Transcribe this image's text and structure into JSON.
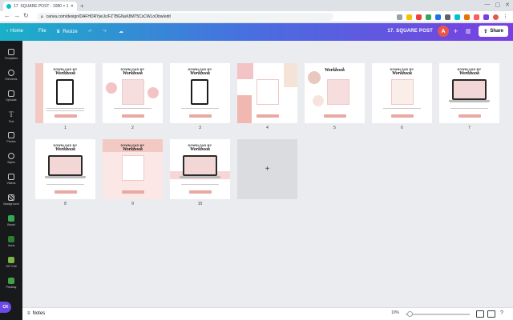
{
  "browser": {
    "tab_title": "17. SQUARE POST - 1080 × 1...",
    "new_tab_glyph": "+",
    "url": "canva.com/design/DAFHDRYjeiJc/FZ7BGNuK8M75CxCWLoObw/edit",
    "window_controls": [
      "—",
      "▢",
      "✕"
    ]
  },
  "toolbar": {
    "back_glyph": "‹",
    "home_label": "Home",
    "file_label": "File",
    "resize_label": "Resize",
    "doc_title": "17. SQUARE POST",
    "avatar_letter": "A",
    "add_glyph": "+",
    "share_label": "Share"
  },
  "sidebar": {
    "items": [
      {
        "label": "Templates"
      },
      {
        "label": "Elements"
      },
      {
        "label": "Uploads"
      },
      {
        "label": "Text"
      },
      {
        "label": "Photos"
      },
      {
        "label": "Styles"
      },
      {
        "label": "Videos"
      },
      {
        "label": "Background"
      },
      {
        "label": "Brand"
      },
      {
        "label": "Icons"
      },
      {
        "label": "GIF Edit"
      },
      {
        "label": "Pixabay"
      }
    ],
    "ck_label": "CK"
  },
  "pages": [
    {
      "number": "1",
      "line1": "DOWNLOAD MY",
      "line2": "Workbook"
    },
    {
      "number": "2",
      "line1": "DOWNLOAD MY",
      "line2": "Workbook"
    },
    {
      "number": "3",
      "line1": "DOWNLOAD MY",
      "line2": "Workbook"
    },
    {
      "number": "4",
      "line1": "",
      "line2": ""
    },
    {
      "number": "5",
      "line1": "",
      "line2": "Workbook"
    },
    {
      "number": "6",
      "line1": "DOWNLOAD MY",
      "line2": "Workbook"
    },
    {
      "number": "7",
      "line1": "DOWNLOAD MY",
      "line2": "Workbook"
    },
    {
      "number": "8",
      "line1": "DOWNLOAD MY",
      "line2": "Workbook"
    },
    {
      "number": "9",
      "line1": "DOWNLOAD MY",
      "line2": "Workbook"
    },
    {
      "number": "10",
      "line1": "DOWNLOAD MY",
      "line2": "Workbook"
    }
  ],
  "add_page_glyph": "+",
  "bottom_bar": {
    "notes_label": "Notes",
    "zoom_label": "10%",
    "zoom_level_percent": 10
  },
  "colors": {
    "accent_pink": "#e8a9a2",
    "sidebar_bg": "#18191b",
    "toolbar_gradient_start": "#1ab0c8",
    "toolbar_gradient_end": "#7a3fe0"
  }
}
